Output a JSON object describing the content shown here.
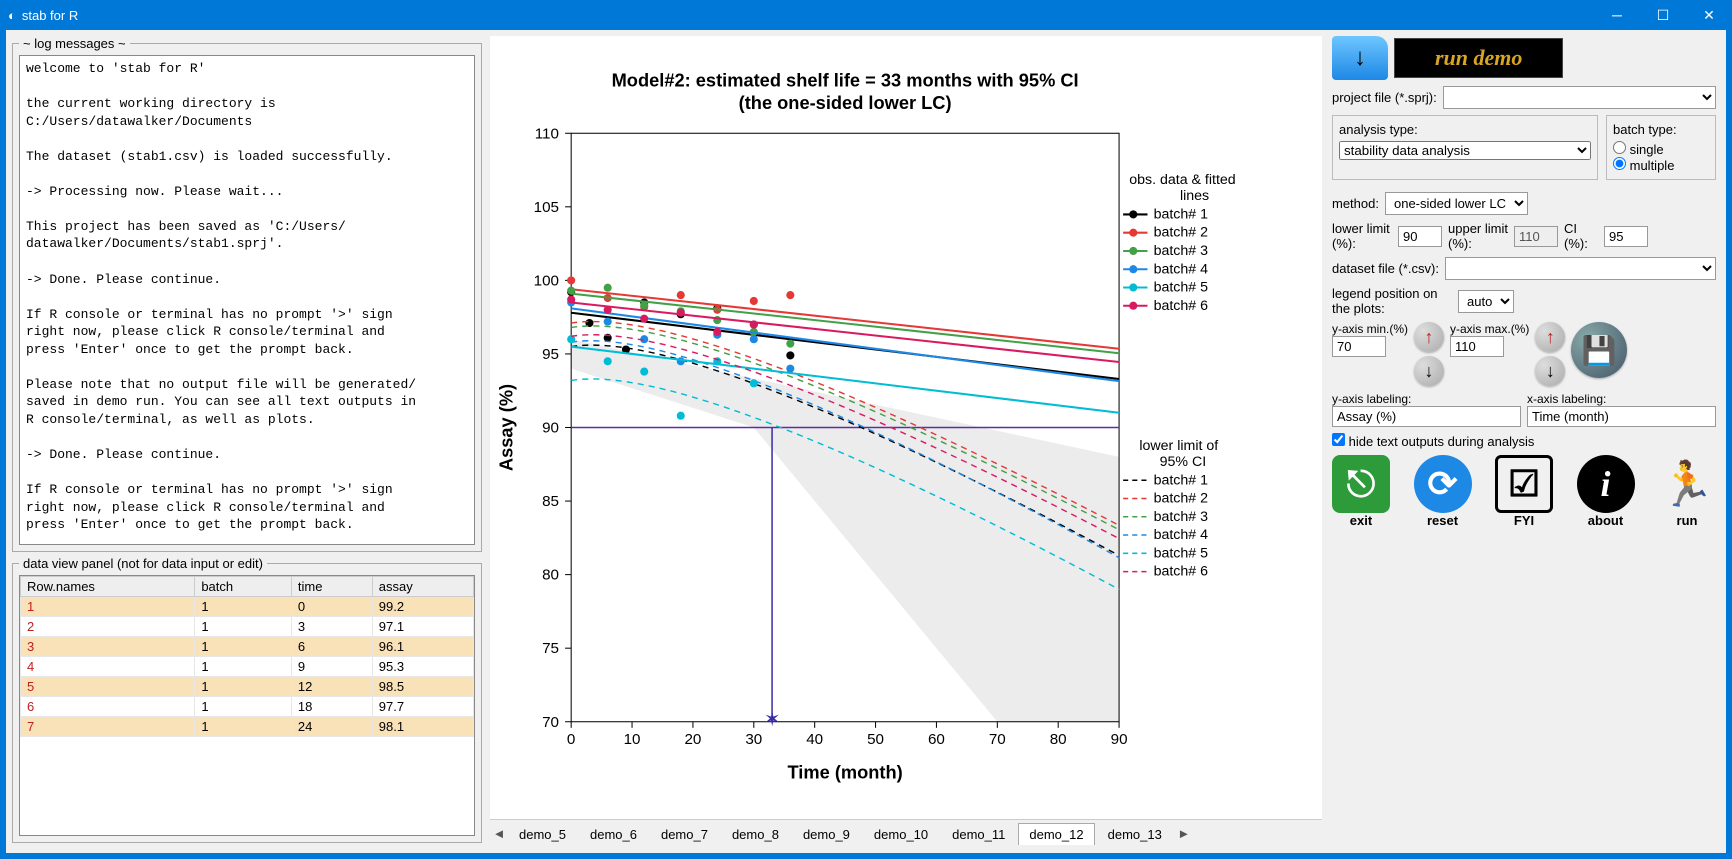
{
  "window": {
    "title": "stab for R"
  },
  "log": {
    "legend": "~ log messages ~",
    "text": "welcome to 'stab for R'\n\nthe current working directory is\nC:/Users/datawalker/Documents\n\nThe dataset (stab1.csv) is loaded successfully.\n\n-> Processing now. Please wait...\n\nThis project has been saved as 'C:/Users/\ndatawalker/Documents/stab1.sprj'.\n\n-> Done. Please continue.\n\nIf R console or terminal has no prompt '>' sign\nright now, please click R console/terminal and\npress 'Enter' once to get the prompt back.\n\nPlease note that no output file will be generated/\nsaved in demo run. You can see all text outputs in\nR console/terminal, as well as plots.\n\n-> Done. Please continue.\n\nIf R console or terminal has no prompt '>' sign\nright now, please click R console/terminal and\npress 'Enter' once to get the prompt back."
  },
  "datapanel": {
    "legend": "data view panel (not for data input or edit)",
    "headers": [
      "Row.names",
      "batch",
      "time",
      "assay"
    ],
    "rows": [
      [
        "1",
        "1",
        "0",
        "99.2"
      ],
      [
        "2",
        "1",
        "3",
        "97.1"
      ],
      [
        "3",
        "1",
        "6",
        "96.1"
      ],
      [
        "4",
        "1",
        "9",
        "95.3"
      ],
      [
        "5",
        "1",
        "12",
        "98.5"
      ],
      [
        "6",
        "1",
        "18",
        "97.7"
      ],
      [
        "7",
        "1",
        "24",
        "98.1"
      ]
    ]
  },
  "chart_data": {
    "type": "scatter",
    "title": "Model#2: estimated shelf life = 33 months with 95% CI",
    "subtitle": "(the one-sided lower LC)",
    "xlabel": "Time (month)",
    "ylabel": "Assay (%)",
    "xlim": [
      0,
      90
    ],
    "ylim": [
      70,
      110
    ],
    "xticks": [
      0,
      10,
      20,
      30,
      40,
      50,
      60,
      70,
      80,
      90
    ],
    "yticks": [
      70,
      75,
      80,
      85,
      90,
      95,
      100,
      105,
      110
    ],
    "lower_limit_line": 90,
    "shelf_life_mark_x": 33,
    "legends": {
      "fitted_title": "obs. data & fitted lines",
      "fitted_items": [
        "batch# 1",
        "batch# 2",
        "batch# 3",
        "batch# 4",
        "batch# 5",
        "batch# 6"
      ],
      "ci_title": "lower limit of 95% CI",
      "ci_items": [
        "batch#  1",
        "batch#  2",
        "batch#  3",
        "batch#  4",
        "batch#  5",
        "batch#  6"
      ]
    },
    "colors": {
      "1": "#000000",
      "2": "#e53935",
      "3": "#43a047",
      "4": "#1e88e5",
      "5": "#00bcd4",
      "6": "#d81b60"
    },
    "series": [
      {
        "name": "batch# 1",
        "color": "#000000",
        "points": [
          [
            0,
            99.2
          ],
          [
            3,
            97.1
          ],
          [
            6,
            96.1
          ],
          [
            9,
            95.3
          ],
          [
            12,
            98.5
          ],
          [
            18,
            97.7
          ],
          [
            24,
            98.1
          ],
          [
            30,
            97.0
          ],
          [
            36,
            94.9
          ]
        ],
        "line": {
          "a": 97.8,
          "b": -0.05
        }
      },
      {
        "name": "batch# 2",
        "color": "#e53935",
        "points": [
          [
            0,
            100.0
          ],
          [
            6,
            98.8
          ],
          [
            12,
            98.2
          ],
          [
            18,
            99.0
          ],
          [
            24,
            98.0
          ],
          [
            30,
            98.6
          ],
          [
            36,
            99.0
          ]
        ],
        "line": {
          "a": 99.4,
          "b": -0.045
        }
      },
      {
        "name": "batch# 3",
        "color": "#43a047",
        "points": [
          [
            0,
            99.3
          ],
          [
            6,
            99.5
          ],
          [
            12,
            98.3
          ],
          [
            18,
            97.9
          ],
          [
            24,
            97.3
          ],
          [
            30,
            96.5
          ],
          [
            36,
            95.7
          ]
        ],
        "line": {
          "a": 99.1,
          "b": -0.045
        }
      },
      {
        "name": "batch# 4",
        "color": "#1e88e5",
        "points": [
          [
            0,
            98.5
          ],
          [
            6,
            97.2
          ],
          [
            12,
            96.0
          ],
          [
            18,
            94.5
          ],
          [
            24,
            96.3
          ],
          [
            30,
            96.0
          ],
          [
            36,
            94.0
          ]
        ],
        "line": {
          "a": 98.1,
          "b": -0.055
        }
      },
      {
        "name": "batch# 5",
        "color": "#00bcd4",
        "points": [
          [
            0,
            96.0
          ],
          [
            6,
            94.5
          ],
          [
            12,
            93.8
          ],
          [
            18,
            90.8
          ],
          [
            24,
            94.5
          ],
          [
            30,
            93.0
          ]
        ],
        "line": {
          "a": 95.5,
          "b": -0.05
        }
      },
      {
        "name": "batch# 6",
        "color": "#d81b60",
        "points": [
          [
            0,
            98.7
          ],
          [
            6,
            98.0
          ],
          [
            12,
            97.4
          ],
          [
            18,
            97.8
          ],
          [
            24,
            96.5
          ],
          [
            30,
            97.0
          ]
        ],
        "line": {
          "a": 98.5,
          "b": -0.045
        }
      }
    ]
  },
  "tabs": {
    "items": [
      "demo_5",
      "demo_6",
      "demo_7",
      "demo_8",
      "demo_9",
      "demo_10",
      "demo_11",
      "demo_12",
      "demo_13"
    ],
    "active": "demo_12"
  },
  "right": {
    "rundemo": "run demo",
    "projectfile_label": "project file (*.sprj):",
    "projectfile_value": "",
    "analysis_label": "analysis type:",
    "analysis_value": "stability data analysis",
    "batchtype_label": "batch type:",
    "batchtype_single": "single",
    "batchtype_multiple": "multiple",
    "method_label": "method:",
    "method_value": "one-sided lower LC",
    "lowerlimit_label": "lower limit (%):",
    "lowerlimit_value": "90",
    "upperlimit_label": "upper limit (%):",
    "upperlimit_value": "110",
    "ci_label": "CI (%):",
    "ci_value": "95",
    "datasetfile_label": "dataset file (*.csv):",
    "datasetfile_value": "",
    "legendpos_label": "legend position on the plots:",
    "legendpos_value": "auto",
    "ymin_label": "y-axis min.(%)",
    "ymin_value": "70",
    "ymax_label": "y-axis max.(%)",
    "ymax_value": "110",
    "ylabel_label": "y-axis labeling:",
    "ylabel_value": "Assay (%)",
    "xlabel_label": "x-axis labeling:",
    "xlabel_value": "Time (month)",
    "hide_outputs_label": "hide text outputs during analysis",
    "buttons": {
      "exit": "exit",
      "reset": "reset",
      "fyi": "FYI",
      "about": "about",
      "run": "run"
    }
  }
}
